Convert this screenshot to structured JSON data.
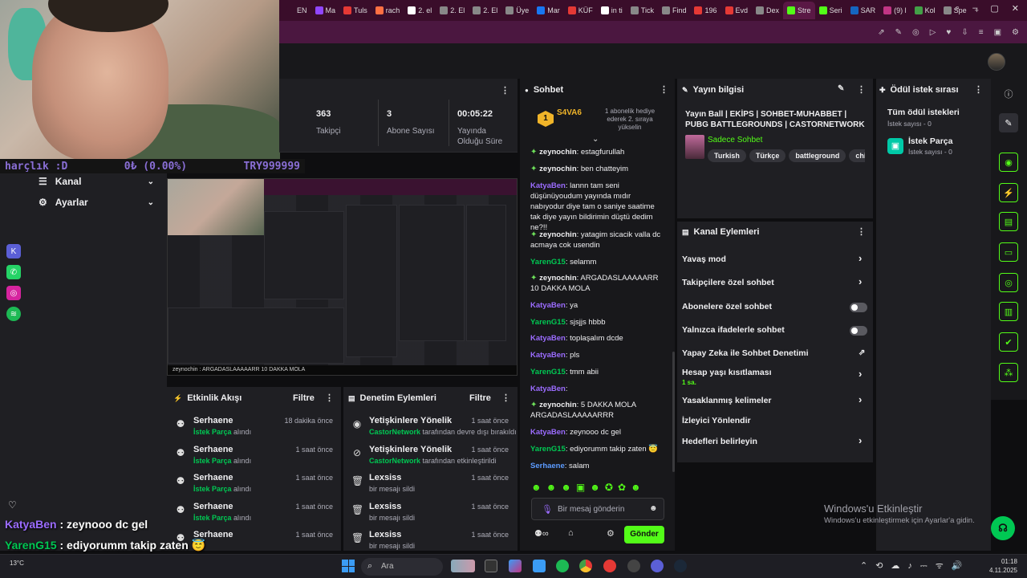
{
  "browser": {
    "tabs": [
      {
        "label": "EN",
        "color": "#3a0d2a"
      },
      {
        "label": "Ma",
        "color": "#9146ff"
      },
      {
        "label": "Tuls",
        "color": "#e53935"
      },
      {
        "label": "rach",
        "color": "#ff7043"
      },
      {
        "label": "2. el",
        "color": "#ffffff"
      },
      {
        "label": "2. El",
        "color": "#888888"
      },
      {
        "label": "2. El",
        "color": "#888888"
      },
      {
        "label": "Üye",
        "color": "#888888"
      },
      {
        "label": "Mar",
        "color": "#1877f2"
      },
      {
        "label": "KÜF",
        "color": "#e53935"
      },
      {
        "label": "in ti",
        "color": "#ffffff"
      },
      {
        "label": "Tick",
        "color": "#888888"
      },
      {
        "label": "Find",
        "color": "#888888"
      },
      {
        "label": "196",
        "color": "#e53935"
      },
      {
        "label": "Evd",
        "color": "#e53935"
      },
      {
        "label": "Dex",
        "color": "#888888"
      },
      {
        "label": "Stre",
        "color": "#53fc18",
        "active": true
      },
      {
        "label": "Seri",
        "color": "#53fc18"
      },
      {
        "label": "SAR",
        "color": "#1565c0"
      },
      {
        "label": "(9) l",
        "color": "#c13584"
      },
      {
        "label": "Kol",
        "color": "#43a047"
      },
      {
        "label": "Spe",
        "color": "#888888"
      }
    ],
    "address_icons": [
      "⇗",
      "✎",
      "◎",
      "▷",
      "♥",
      "⇩",
      "≡",
      "▣",
      "⚙"
    ]
  },
  "overlay": {
    "donation_left": "harçlık :D",
    "donation_mid": "0₺ (0.00%)",
    "donation_right": "TRY999999",
    "chat": [
      {
        "user": "KatyaBen",
        "text": ": zeynooo dc gel",
        "color": "#9b6cff"
      },
      {
        "user": "YarenG15",
        "text": ": ediyorumm takip zaten 😇",
        "color": "#00c853"
      },
      {
        "user": "Serhaene",
        "text": ": salam",
        "color": "#5c9bff"
      }
    ]
  },
  "nav": {
    "kanal": "Kanal",
    "ayarlar": "Ayarlar"
  },
  "stats": {
    "followers_num": "363",
    "followers_lbl": "Takipçi",
    "subs_num": "3",
    "subs_lbl": "Abone Sayısı",
    "time_num": "00:05:22",
    "time_lbl1": "Yayında",
    "time_lbl2": "Olduğu Süre"
  },
  "preview": {
    "caption": "zeynochin : ARGADASLAAAAARR 10 DAKKA MOLA"
  },
  "activity": {
    "title": "Etkinlik Akışı",
    "filter": "Filtre",
    "items": [
      {
        "name": "Serhaene",
        "reward": "İstek Parça",
        "suffix": "alındı",
        "time": "18 dakika önce"
      },
      {
        "name": "Serhaene",
        "reward": "İstek Parça",
        "suffix": "alındı",
        "time": "1 saat önce"
      },
      {
        "name": "Serhaene",
        "reward": "İstek Parça",
        "suffix": "alındı",
        "time": "1 saat önce"
      },
      {
        "name": "Serhaene",
        "reward": "İstek Parça",
        "suffix": "alındı",
        "time": "1 saat önce"
      },
      {
        "name": "Serhaene",
        "reward": "",
        "suffix": "",
        "time": "1 saat önce"
      }
    ]
  },
  "moderation": {
    "title": "Denetim Eylemleri",
    "filter": "Filtre",
    "items": [
      {
        "name": "Yetişkinlere Yönelik",
        "actor": "CastorNetwork",
        "detail": "tarafından devre dışı bırakıldı",
        "time": "1 saat önce"
      },
      {
        "name": "Yetişkinlere Yönelik",
        "actor": "CastorNetwork",
        "detail": "tarafından etkinleştirildi",
        "time": "1 saat önce"
      },
      {
        "name": "Lexsiss",
        "actor": "",
        "detail": "bir mesajı sildi",
        "time": "1 saat önce"
      },
      {
        "name": "Lexsiss",
        "actor": "",
        "detail": "bir mesajı sildi",
        "time": "1 saat önce"
      },
      {
        "name": "Lexsiss",
        "actor": "",
        "detail": "bir mesajı sildi",
        "time": "1 saat önce"
      }
    ]
  },
  "chat": {
    "title": "Sohbet",
    "gift_user": "S4VA6",
    "gift_rank": "1",
    "gift_text": "1 abonelik hediye ederek 2. sıraya yükselin",
    "input_placeholder": "Bir mesaj gönderin",
    "send": "Gönder",
    "messages": [
      {
        "user": "zeynochin",
        "text": ": estagfurullah",
        "cls": "u-z",
        "gem": true
      },
      {
        "user": "zeynochin",
        "text": ": ben chatteyim",
        "cls": "u-z",
        "gem": true
      },
      {
        "user": "KatyaBen",
        "text": ": lannn tam seni düşünüyoudum yayında mıdır nabıyodur diye tam o saniye saatime tak diye yayın bildirimin düştü dedim ne?!!",
        "cls": "u-k",
        "gem": false
      },
      {
        "user": "zeynochin",
        "text": ": yatagim sicacik valla dc acmaya cok usendin",
        "cls": "u-z",
        "gem": true
      },
      {
        "user": "YarenG15",
        "text": ": selamm",
        "cls": "u-y",
        "gem": false
      },
      {
        "user": "zeynochin",
        "text": ": ARGADASLAAAAARR 10 DAKKA MOLA",
        "cls": "u-z",
        "gem": true
      },
      {
        "user": "KatyaBen",
        "text": ": ya",
        "cls": "u-k",
        "gem": false
      },
      {
        "user": "YarenG15",
        "text": ": sjsjjs hbbb",
        "cls": "u-y",
        "gem": false
      },
      {
        "user": "KatyaBen",
        "text": ": toplaşalım dcde",
        "cls": "u-k",
        "gem": false
      },
      {
        "user": "KatyaBen",
        "text": ": pls",
        "cls": "u-k",
        "gem": false
      },
      {
        "user": "YarenG15",
        "text": ": tmm abii",
        "cls": "u-y",
        "gem": false
      },
      {
        "user": "KatyaBen",
        "text": ":",
        "cls": "u-k",
        "gem": false
      },
      {
        "user": "zeynochin",
        "text": ": 5 DAKKA MOLA ARGADASLAAAAARRR",
        "cls": "u-z",
        "gem": true
      },
      {
        "user": "KatyaBen",
        "text": ": zeynooo dc gel",
        "cls": "u-k",
        "gem": false
      },
      {
        "user": "YarenG15",
        "text": ": ediyorumm takip zaten 😇",
        "cls": "u-y",
        "gem": false
      },
      {
        "user": "Serhaene",
        "text": ": salam",
        "cls": "u-s",
        "gem": false
      }
    ]
  },
  "info": {
    "title": "Yayın bilgisi",
    "stream_title": "Yayın Ball | EKİPS | SOHBET-MUHABBET | PUBG BATTLEGROUNDS | CASTORNETWORK",
    "category": "Sadece Sohbet",
    "tags": [
      "Turkish",
      "Türkçe",
      "battleground",
      "chill",
      "fr"
    ]
  },
  "rewards": {
    "title": "Ödül istek sırası",
    "all_title": "Tüm ödül istekleri",
    "all_count": "İstek sayısı - 0",
    "item_title": "İstek Parça",
    "item_count": "İstek sayısı - 0"
  },
  "actions": {
    "title": "Kanal Eylemleri",
    "items": [
      {
        "label": "Yavaş mod",
        "control": "chevron"
      },
      {
        "label": "Takipçilere özel sohbet",
        "control": "chevron"
      },
      {
        "label": "Abonelere özel sohbet",
        "control": "toggle"
      },
      {
        "label": "Yalnızca ifadelerle sohbet",
        "control": "toggle"
      },
      {
        "label": "Yapay Zeka ile Sohbet Denetimi",
        "control": "external"
      },
      {
        "label": "Hesap yaşı kısıtlaması",
        "sub": "1 sa.",
        "control": "chevron"
      },
      {
        "label": "Yasaklanmış kelimeler",
        "control": "chevron"
      },
      {
        "label": "İzleyici Yönlendir",
        "control": "none"
      },
      {
        "label": "Hedefleri belirleyin",
        "control": "chevron"
      }
    ]
  },
  "watermark": {
    "title": "Windows'u Etkinleştir",
    "sub": "Windows'u etkinleştirmek için Ayarlar'a gidin."
  },
  "taskbar": {
    "weather": "13°C",
    "search": "Ara",
    "time": "01:18",
    "date": "4.11.2025"
  }
}
